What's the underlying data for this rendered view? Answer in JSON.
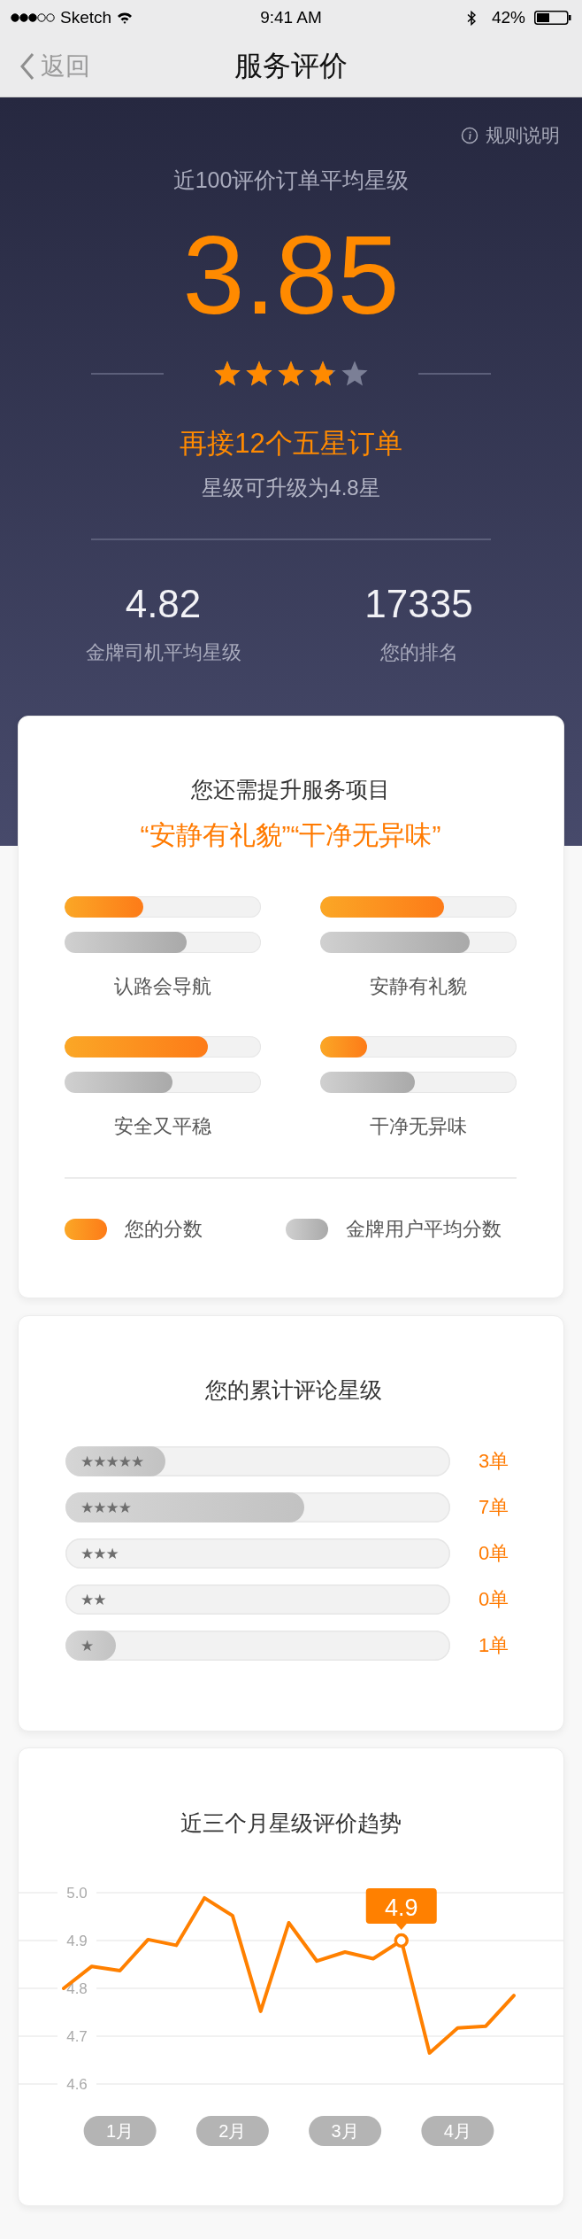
{
  "status_bar": {
    "carrier": "Sketch",
    "time": "9:41 AM",
    "battery": "42%"
  },
  "nav": {
    "back": "返回",
    "title": "服务评价"
  },
  "summary": {
    "rules_link": "规则说明",
    "caption": "近100评价订单平均星级",
    "score": "3.85",
    "stars": 3.85,
    "upgrade_hint": "再接12个五星订单",
    "upgrade_note": "星级可升级为4.8星",
    "stats": [
      {
        "value": "4.82",
        "label": "金牌司机平均星级"
      },
      {
        "value": "17335",
        "label": "您的排名"
      }
    ]
  },
  "improve_card": {
    "title": "您还需提升服务项目",
    "highlight": "“安静有礼貌”“干净无异味”",
    "items": [
      {
        "label": "认路会导航",
        "bars": [
          {
            "kind": "yours",
            "level": 0.4
          },
          {
            "kind": "gold_average",
            "level": 0.62
          }
        ]
      },
      {
        "label": "安静有礼貌",
        "bars": [
          {
            "kind": "yours",
            "level": 0.63
          },
          {
            "kind": "gold_average",
            "level": 0.76
          }
        ]
      },
      {
        "label": "安全又平稳",
        "bars": [
          {
            "kind": "yours",
            "level": 0.73
          },
          {
            "kind": "gold_average",
            "level": 0.55
          }
        ]
      },
      {
        "label": "干净无异味",
        "bars": [
          {
            "kind": "yours",
            "level": 0.24
          },
          {
            "kind": "gold_average",
            "level": 0.48
          }
        ]
      }
    ],
    "legend": [
      {
        "kind": "yours",
        "label": "您的分数"
      },
      {
        "kind": "gold_average",
        "label": "金牌用户平均分数"
      }
    ]
  },
  "rating_card": {
    "title": "您的累计评论星级",
    "rows": [
      {
        "label": "★★★★★",
        "level": 0.26,
        "count": "3单"
      },
      {
        "label": "★★★★",
        "level": 0.62,
        "count": "7单"
      },
      {
        "label": "★★★",
        "count": "0单"
      },
      {
        "label": "★★",
        "count": "0单"
      },
      {
        "label": "★",
        "level": 0.13,
        "count": "1单"
      }
    ]
  },
  "trend_card": {
    "title": "近三个月星级评价趋势",
    "chart_data": {
      "type": "line",
      "categories": [
        null,
        null,
        "1月",
        null,
        null,
        null,
        "2月",
        null,
        null,
        null,
        "3月",
        null,
        null,
        null,
        "4月",
        null,
        null
      ],
      "ylim": [
        4.6,
        5.0
      ],
      "yticks": [
        {
          "value": 5,
          "label": "5.0"
        },
        4.9,
        4.8,
        4.7,
        4.6
      ],
      "series": [
        {
          "color": "#ff8000",
          "values": [
            4.8,
            4.846,
            4.837,
            4.902,
            4.89,
            4.989,
            4.952,
            4.752,
            4.937,
            4.857,
            4.876,
            4.862,
            4.9,
            4.665,
            4.717,
            4.721,
            4.785
          ]
        }
      ],
      "grid": true,
      "annotations": [
        {
          "y": 4.9,
          "text": "4.9"
        }
      ]
    }
  }
}
